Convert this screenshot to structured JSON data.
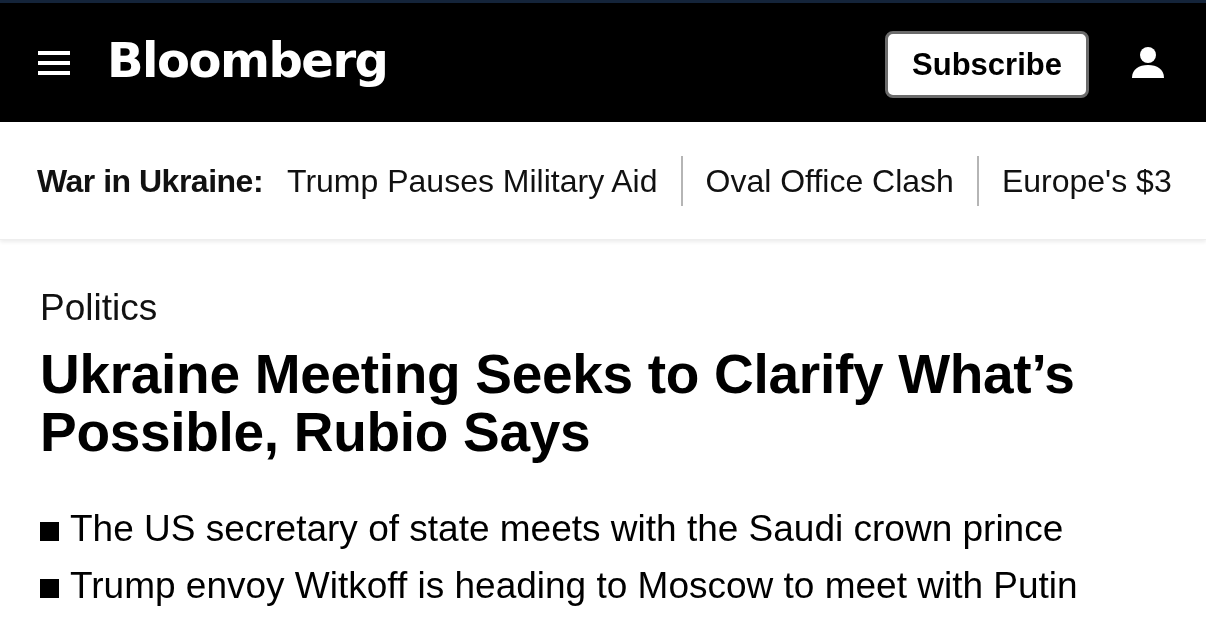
{
  "header": {
    "logo": "Bloomberg",
    "subscribe_button": "Subscribe"
  },
  "topic_bar": {
    "label": "War in Ukraine:",
    "links": [
      "Trump Pauses Military Aid",
      "Oval Office Clash",
      "Europe's $3"
    ]
  },
  "article": {
    "section": "Politics",
    "headline": "Ukraine Meeting Seeks to Clarify What’s Possible, Rubio Says",
    "bullets": [
      "The US secretary of state meets with the Saudi crown prince",
      "Trump envoy Witkoff is heading to Moscow to meet with Putin"
    ]
  }
}
